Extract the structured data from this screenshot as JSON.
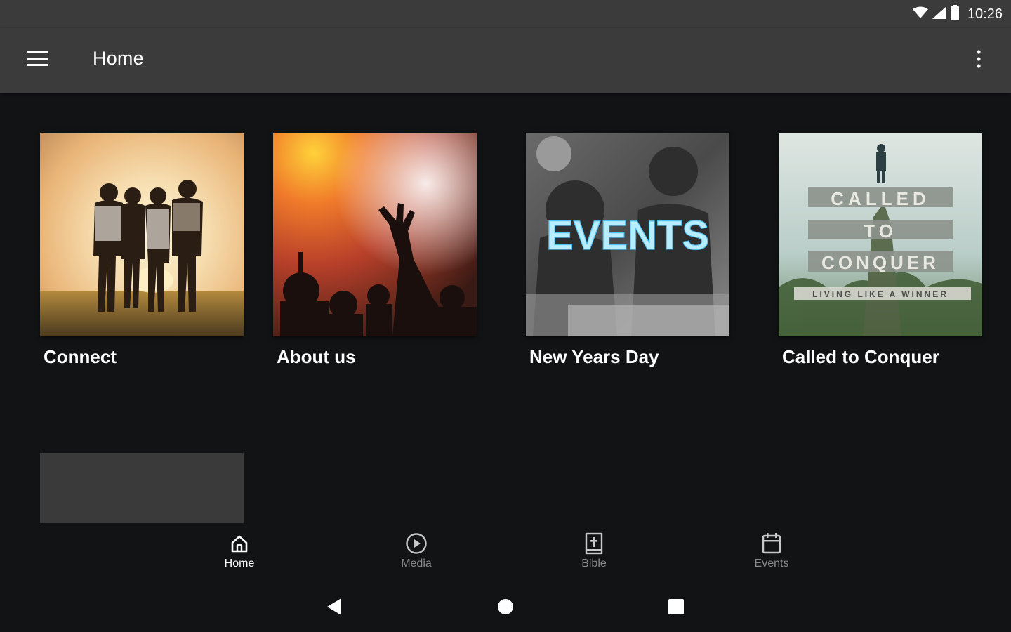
{
  "status_bar": {
    "time": "10:26",
    "icons": [
      "wifi-icon",
      "cellular-signal-icon",
      "battery-icon"
    ]
  },
  "app_bar": {
    "title": "Home",
    "menu_icon": "hamburger-menu-icon",
    "overflow_icon": "more-vert-icon"
  },
  "cards": [
    {
      "title": "Connect",
      "image": "friends-hugging-sunset-photo"
    },
    {
      "title": "About us",
      "image": "worship-concert-crowd-photo"
    },
    {
      "title": "New Years Day",
      "image": "events-banner-photo",
      "image_text": "EVENTS"
    },
    {
      "title": "Called to Conquer",
      "image": "called-to-conquer-series-art",
      "image_text": [
        "CALLED",
        "TO",
        "CONQUER",
        "LIVING LIKE A WINNER"
      ]
    }
  ],
  "bottom_nav": {
    "items": [
      {
        "label": "Home",
        "icon": "home-icon",
        "active": true
      },
      {
        "label": "Media",
        "icon": "play-circle-icon",
        "active": false
      },
      {
        "label": "Bible",
        "icon": "bible-icon",
        "active": false
      },
      {
        "label": "Events",
        "icon": "calendar-icon",
        "active": false
      }
    ]
  },
  "system_nav": {
    "back_icon": "back-triangle-icon",
    "home_icon": "home-circle-icon",
    "recents_icon": "recents-square-icon"
  },
  "colors": {
    "app_bar": "#3b3b3b",
    "background": "#121315",
    "active_nav": "#ffffff",
    "inactive_nav": "#8a8a8a",
    "events_neon": "#4fc3f7"
  }
}
